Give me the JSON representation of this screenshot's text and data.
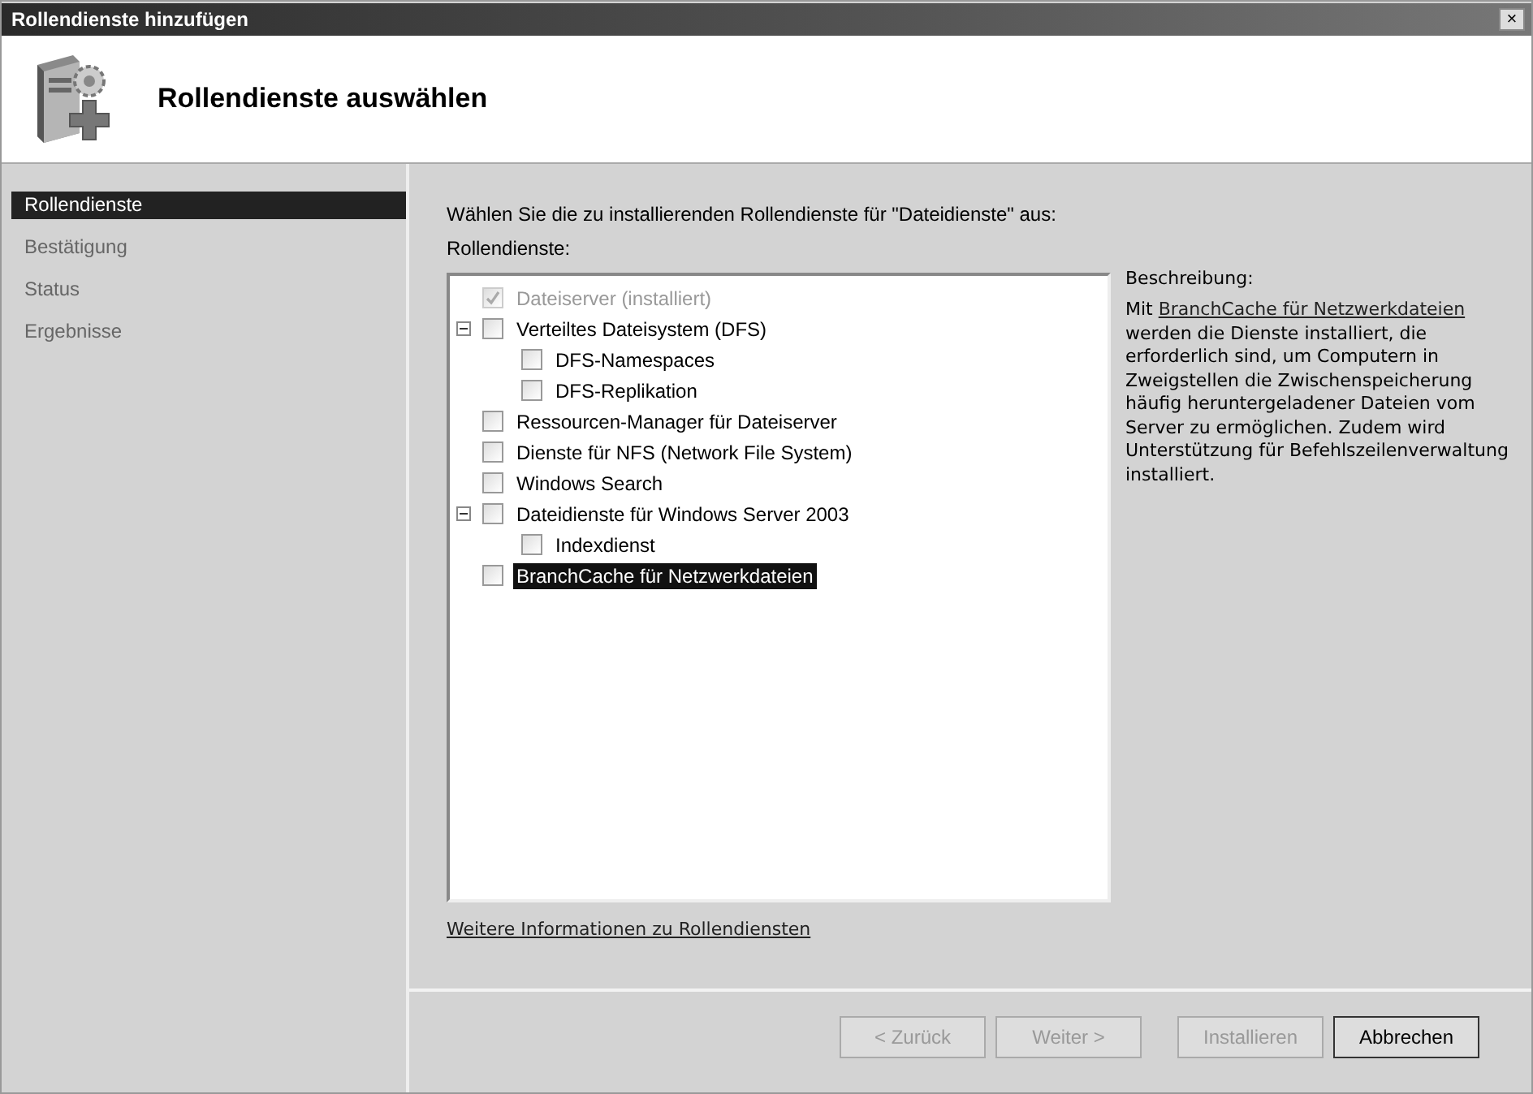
{
  "window": {
    "title": "Rollendienste hinzufügen",
    "close": "×"
  },
  "header": {
    "title": "Rollendienste auswählen"
  },
  "sidebar": {
    "items": [
      {
        "label": "Rollendienste",
        "selected": true
      },
      {
        "label": "Bestätigung",
        "selected": false
      },
      {
        "label": "Status",
        "selected": false
      },
      {
        "label": "Ergebnisse",
        "selected": false
      }
    ]
  },
  "instruction": "Wählen Sie die zu installierenden Rollendienste für \"Dateidienste\" aus:",
  "tree_label": "Rollendienste:",
  "tree": [
    {
      "label": "Dateiserver (installiert)",
      "checked": true,
      "disabled": true,
      "selected": false
    },
    {
      "label": "Verteiltes Dateisystem (DFS)",
      "checked": false,
      "disabled": false,
      "selected": false,
      "expanded": true,
      "children": [
        {
          "label": "DFS-Namespaces",
          "checked": false,
          "disabled": false,
          "selected": false
        },
        {
          "label": "DFS-Replikation",
          "checked": false,
          "disabled": false,
          "selected": false
        }
      ]
    },
    {
      "label": "Ressourcen-Manager für Dateiserver",
      "checked": false,
      "disabled": false,
      "selected": false
    },
    {
      "label": "Dienste für NFS (Network File System)",
      "checked": false,
      "disabled": false,
      "selected": false
    },
    {
      "label": "Windows Search",
      "checked": false,
      "disabled": false,
      "selected": false
    },
    {
      "label": "Dateidienste für Windows Server 2003",
      "checked": false,
      "disabled": false,
      "selected": false,
      "expanded": true,
      "children": [
        {
          "label": "Indexdienst",
          "checked": false,
          "disabled": false,
          "selected": false
        }
      ]
    },
    {
      "label": "BranchCache für Netzwerkdateien",
      "checked": false,
      "disabled": false,
      "selected": true
    }
  ],
  "description": {
    "heading": "Beschreibung:",
    "before": "Mit",
    "link": "BranchCache für Netzwerkdateien",
    "after": "werden die Dienste installiert, die erforderlich sind, um Computern in Zweigstellen die Zwischenspeicherung häufig heruntergeladener Dateien vom Server zu ermöglichen. Zudem wird Unterstützung für Befehlszeilenverwaltung installiert."
  },
  "more_info_link": "Weitere Informationen zu Rollendiensten",
  "buttons": [
    {
      "label": "< Zurück",
      "disabled": true
    },
    {
      "label": "Weiter >",
      "disabled": true
    },
    {
      "label": "Installieren",
      "disabled": true
    },
    {
      "label": "Abbrechen",
      "disabled": false
    }
  ]
}
